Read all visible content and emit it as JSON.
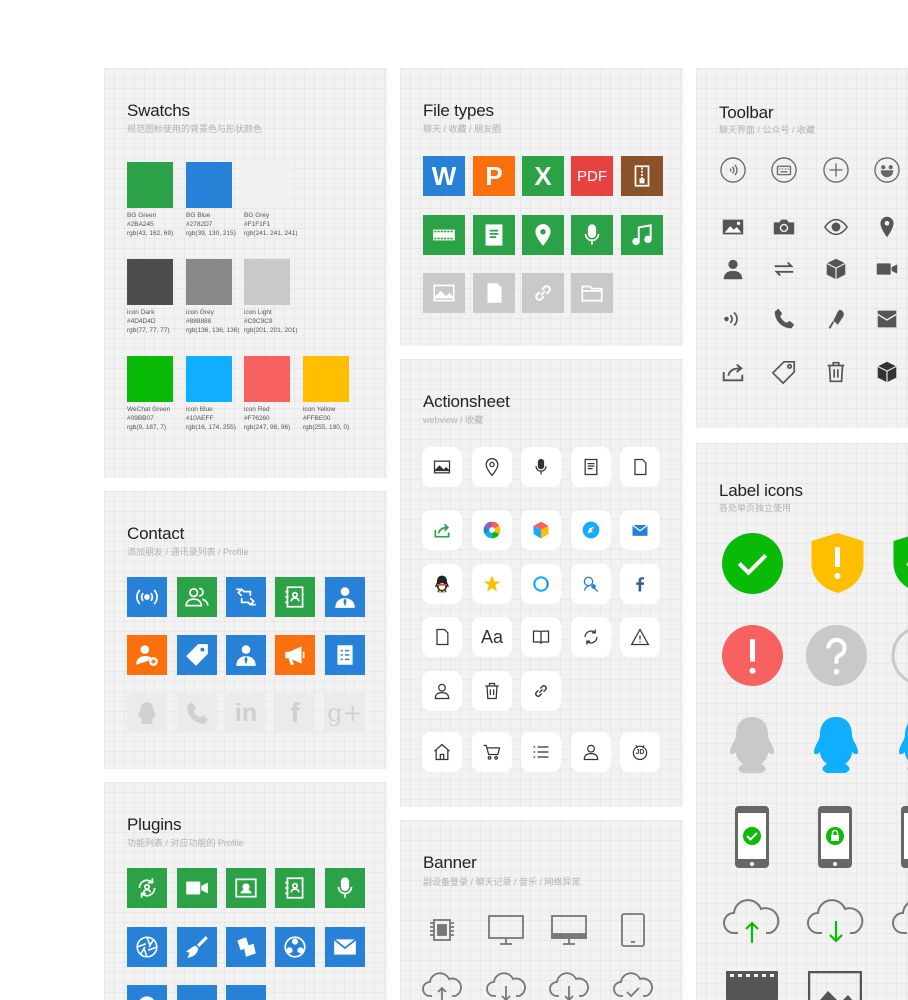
{
  "cards": {
    "swatchs": {
      "title": "Swatchs",
      "subtitle": "规范图标使用的背景色与形状颜色"
    },
    "file_types": {
      "title": "File types",
      "subtitle": "聊天 / 收藏 / 朋友圈"
    },
    "toolbar": {
      "title": "Toolbar",
      "subtitle": "聊天界面 / 公众号 / 收藏"
    },
    "contact": {
      "title": "Contact",
      "subtitle": "添加朋友 / 通讯录列表 / Profile"
    },
    "actionsheet": {
      "title": "Actionsheet",
      "subtitle": "webview / 收藏"
    },
    "label_icons": {
      "title": "Label icons",
      "subtitle": "各处单页独立使用"
    },
    "plugins": {
      "title": "Plugins",
      "subtitle": "功能列表 / 对应功能的 Profile"
    },
    "banner": {
      "title": "Banner",
      "subtitle": "副设备登录 / 聊天记录 / 音乐 / 网络异常"
    }
  },
  "swatches": [
    {
      "name": "BG Green",
      "hex": "#2BA245",
      "rgb": "rgb(43, 162, 69)",
      "color": "#2BA245"
    },
    {
      "name": "BG Blue",
      "hex": "#2782D7",
      "rgb": "rgb(39, 130, 215)",
      "color": "#2782D7"
    },
    {
      "name": "BG Grey",
      "hex": "#F1F1F1",
      "rgb": "rgb(241, 241, 241)",
      "color": "#F1F1F1"
    },
    {
      "name": "icon Dark",
      "hex": "#4D4D4D",
      "rgb": "rgb(77, 77, 77)",
      "color": "#4D4D4D"
    },
    {
      "name": "icon Grey",
      "hex": "#888888",
      "rgb": "rgb(136, 136, 136)",
      "color": "#888888"
    },
    {
      "name": "icon Light",
      "hex": "#C9C9C9",
      "rgb": "rgb(201, 201, 201)",
      "color": "#C9C9C9"
    },
    {
      "name": "WeChat Green",
      "hex": "#09BB07",
      "rgb": "rgb(9, 187, 7)",
      "color": "#09BB07"
    },
    {
      "name": "icon Blue",
      "hex": "#10AEFF",
      "rgb": "rgb(16, 174, 255)",
      "color": "#10AEFF"
    },
    {
      "name": "icon Red",
      "hex": "#F76260",
      "rgb": "rgb(247, 98, 96)",
      "color": "#F76260"
    },
    {
      "name": "icon Yellow",
      "hex": "#FFBE00",
      "rgb": "rgb(255, 190, 0)",
      "color": "#FFBE00"
    }
  ],
  "file_types": {
    "word": "W",
    "powerpoint": "P",
    "excel": "X",
    "pdf": "PDF"
  },
  "contact_social": {
    "linkedin": "in",
    "facebook": "f",
    "google_plus": "g+"
  },
  "actionsheet_font_label": "Aa",
  "actionsheet_jd_label": "JD",
  "colors": {
    "green": "#2BA245",
    "blue": "#2782D7",
    "orange": "#FA6F0E",
    "red": "#E64340",
    "brown": "#8B5229",
    "light": "#C9C9C9",
    "yellow": "#FFBE00",
    "qq_blue": "#10AEFF"
  },
  "icons": {
    "toolbar": [
      "voice-icon",
      "keyboard-icon",
      "plus-icon",
      "emoji-icon",
      "image-icon",
      "camera-icon",
      "eye-icon",
      "location-icon",
      "person-icon",
      "transfer-icon",
      "cube-icon",
      "video-icon",
      "speaker-icon",
      "phone-icon",
      "mic-icon",
      "envelope-icon",
      "share-icon",
      "tag-icon",
      "trash-icon",
      "cube-dark-icon"
    ]
  }
}
